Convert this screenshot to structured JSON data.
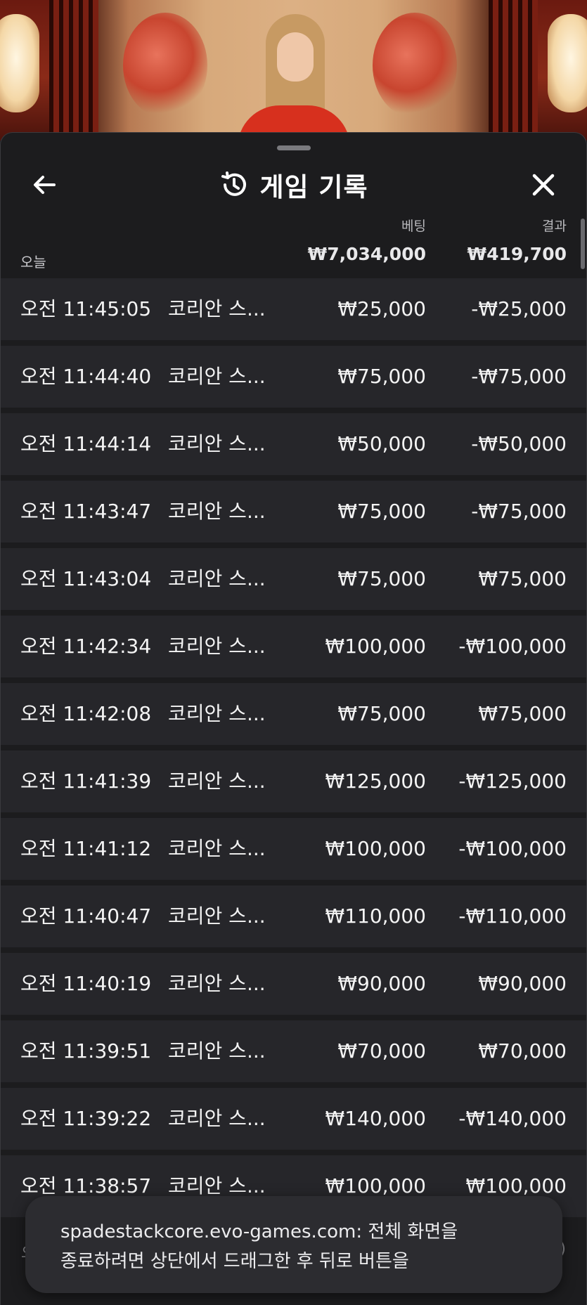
{
  "header": {
    "title": "게임 기록",
    "back_icon": "arrow-left-icon",
    "history_icon": "history-icon",
    "close_icon": "close-icon"
  },
  "columns": {
    "bet": "베팅",
    "result": "결과"
  },
  "summary": {
    "label": "오늘",
    "total_bet": "₩7,034,000",
    "total_result": "₩419,700"
  },
  "rows": [
    {
      "time": "오전 11:45:05",
      "game": "코리안 스...",
      "bet": "₩25,000",
      "result": "-₩25,000"
    },
    {
      "time": "오전 11:44:40",
      "game": "코리안 스...",
      "bet": "₩75,000",
      "result": "-₩75,000"
    },
    {
      "time": "오전 11:44:14",
      "game": "코리안 스...",
      "bet": "₩50,000",
      "result": "-₩50,000"
    },
    {
      "time": "오전 11:43:47",
      "game": "코리안 스...",
      "bet": "₩75,000",
      "result": "-₩75,000"
    },
    {
      "time": "오전 11:43:04",
      "game": "코리안 스...",
      "bet": "₩75,000",
      "result": "₩75,000"
    },
    {
      "time": "오전 11:42:34",
      "game": "코리안 스...",
      "bet": "₩100,000",
      "result": "-₩100,000"
    },
    {
      "time": "오전 11:42:08",
      "game": "코리안 스...",
      "bet": "₩75,000",
      "result": "₩75,000"
    },
    {
      "time": "오전 11:41:39",
      "game": "코리안 스...",
      "bet": "₩125,000",
      "result": "-₩125,000"
    },
    {
      "time": "오전 11:41:12",
      "game": "코리안 스...",
      "bet": "₩100,000",
      "result": "-₩100,000"
    },
    {
      "time": "오전 11:40:47",
      "game": "코리안 스...",
      "bet": "₩110,000",
      "result": "-₩110,000"
    },
    {
      "time": "오전 11:40:19",
      "game": "코리안 스...",
      "bet": "₩90,000",
      "result": "₩90,000"
    },
    {
      "time": "오전 11:39:51",
      "game": "코리안 스...",
      "bet": "₩70,000",
      "result": "₩70,000"
    },
    {
      "time": "오전 11:39:22",
      "game": "코리안 스...",
      "bet": "₩140,000",
      "result": "-₩140,000"
    },
    {
      "time": "오전 11:38:57",
      "game": "코리안 스...",
      "bet": "₩100,000",
      "result": "₩100,000"
    }
  ],
  "toast": {
    "line1": "spadestackcore.evo-games.com: 전체 화면을",
    "line2": "종료하려면 상단에서 드래그한 후 뒤로 버튼을"
  },
  "peek": {
    "left": "오",
    "right": ")"
  },
  "colors": {
    "panel": "#1c1c1e",
    "row": "#26262a",
    "text": "#f4f4f4",
    "muted": "#b8b8bc"
  }
}
